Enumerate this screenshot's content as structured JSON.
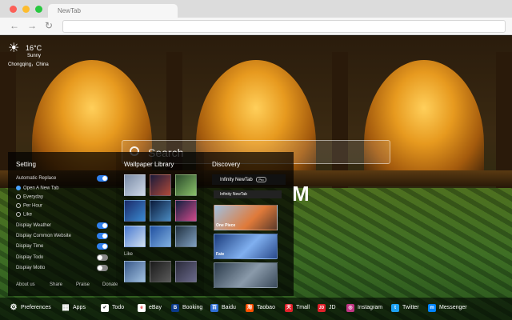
{
  "browser": {
    "tab_title": "NewTab",
    "back": "←",
    "forward": "→",
    "reload": "↻"
  },
  "weather": {
    "temp": "16°C",
    "condition": "Sunny",
    "location": "Chongqing，China",
    "icon": "sun-icon"
  },
  "search": {
    "placeholder": "Search"
  },
  "clock": {
    "visible_text": "M"
  },
  "setting": {
    "title": "Setting",
    "auto_replace": "Automatic Replace",
    "auto_replace_on": true,
    "radios": [
      "Open A New Tab",
      "Everyday",
      "Per Hour",
      "Like"
    ],
    "selected_radio": "Open A New Tab",
    "toggles": [
      {
        "label": "Display Weather",
        "on": true
      },
      {
        "label": "Display Common Website",
        "on": true
      },
      {
        "label": "Display Time",
        "on": true
      },
      {
        "label": "Display Todo",
        "on": false
      },
      {
        "label": "Display Motto",
        "on": false
      }
    ],
    "footer": [
      "About us",
      "Share",
      "Praise",
      "Donate"
    ]
  },
  "wallpaper": {
    "title": "Wallpaper Library",
    "like_label": "Like"
  },
  "discovery": {
    "title": "Discovery",
    "header": "Infinity NewTab",
    "badge": "Pro",
    "sub": "Infinity NewTab",
    "cards": [
      "One Piece",
      "Fate",
      ""
    ]
  },
  "bottombar": {
    "items": [
      {
        "label": "Preferences",
        "icon": "gear-icon",
        "color": "#000000",
        "glyph": "⚙"
      },
      {
        "label": "Apps",
        "icon": "grid-icon",
        "color": "#000000",
        "glyph": "▦"
      },
      {
        "label": "Todo",
        "icon": "check-icon",
        "color": "#ffffff",
        "glyph": "✔"
      },
      {
        "label": "eBay",
        "icon": "ebay-icon",
        "color": "#ffffff",
        "glyph": "e"
      },
      {
        "label": "Booking",
        "icon": "booking-icon",
        "color": "#0b3a8a",
        "glyph": "B"
      },
      {
        "label": "Baidu",
        "icon": "baidu-icon",
        "color": "#2f6fd6",
        "glyph": "百"
      },
      {
        "label": "Taobao",
        "icon": "taobao-icon",
        "color": "#ff5000",
        "glyph": "淘"
      },
      {
        "label": "Tmall",
        "icon": "tmall-icon",
        "color": "#e0202a",
        "glyph": "天"
      },
      {
        "label": "JD",
        "icon": "jd-icon",
        "color": "#e0202a",
        "glyph": "JD"
      },
      {
        "label": "Instagram",
        "icon": "instagram-icon",
        "color": "#c13584",
        "glyph": "◎"
      },
      {
        "label": "Twitter",
        "icon": "twitter-icon",
        "color": "#1da1f2",
        "glyph": "t"
      },
      {
        "label": "Messenger",
        "icon": "messenger-icon",
        "color": "#0084ff",
        "glyph": "m"
      }
    ]
  }
}
